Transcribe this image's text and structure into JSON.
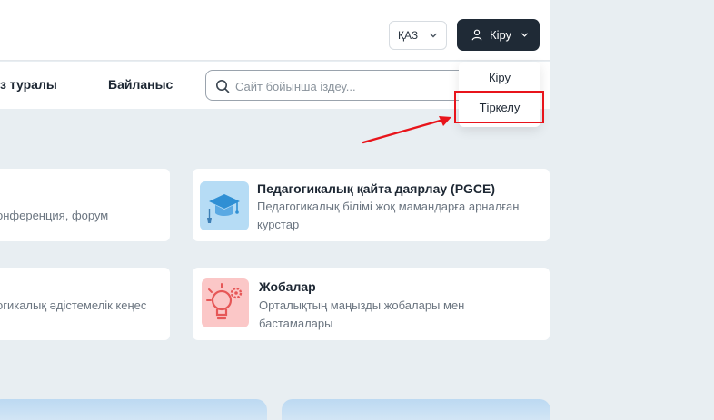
{
  "header": {
    "language_value": "ҚАЗ",
    "login_button_label": "Кіру"
  },
  "nav": {
    "about_label": "Біз туралы",
    "contact_label": "Байланыс",
    "search_placeholder": "Сайт бойынша іздеу..."
  },
  "auth_dropdown": {
    "login_label": "Кіру",
    "register_label": "Тіркелу"
  },
  "cards": {
    "left_top_desc": "онференция, форум",
    "left_bottom_desc": "огикалық әдістемелік кеңес",
    "pgce_title": "Педагогикалық қайта даярлау (PGCE)",
    "pgce_desc": "Педагогикалық білімі жоқ мамандарға арналған курстар",
    "projects_title": "Жобалар",
    "projects_desc": "Орталықтың маңызды жобалары мен бастамалары"
  },
  "colors": {
    "accent_dark": "#1f2a36",
    "highlight_red": "#e8141b",
    "page_bg": "#e8eef2",
    "pgce_icon_bg": "#b6dcf5",
    "projects_icon_bg": "#fbc7c7"
  },
  "icons": [
    "chevron-down-icon",
    "user-icon",
    "search-icon",
    "graduation-cap-icon",
    "lightbulb-gear-icon",
    "red-arrow-annotation"
  ]
}
